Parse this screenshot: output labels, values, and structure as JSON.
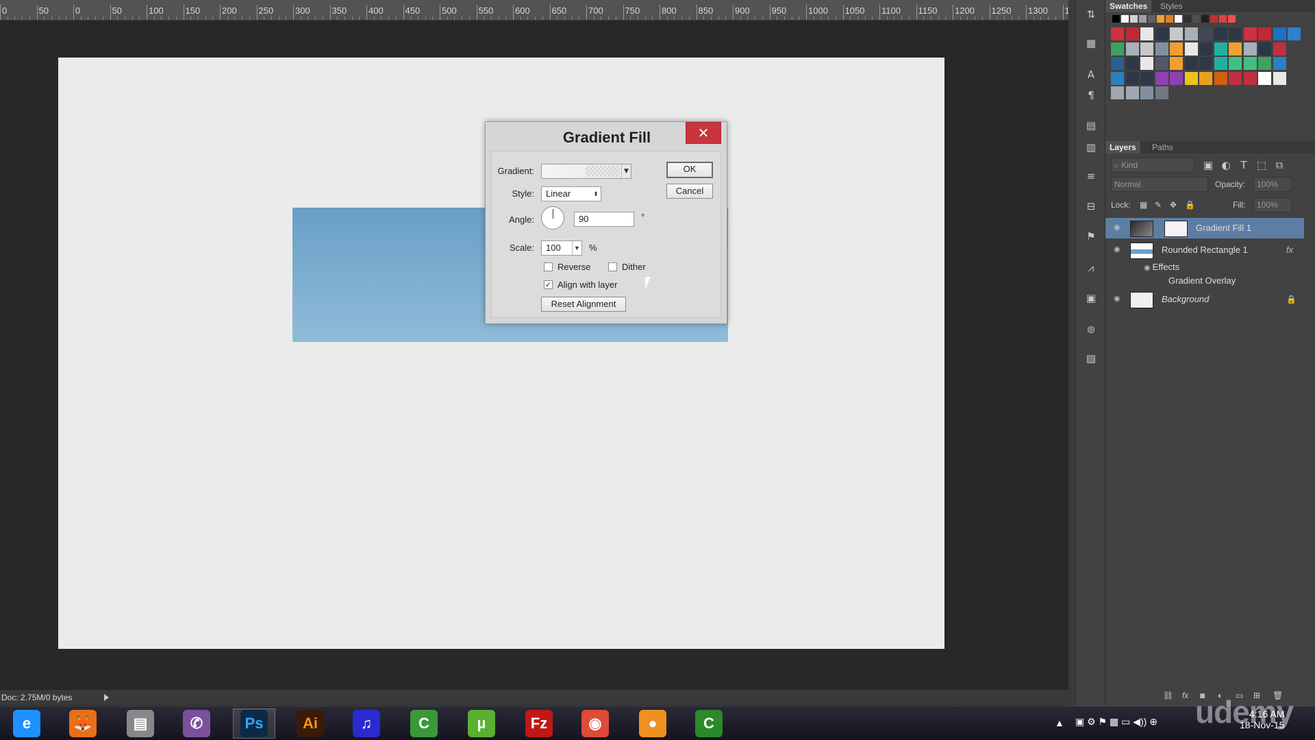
{
  "ruler": {
    "ticks": [
      "0",
      "50",
      "0",
      "50",
      "100",
      "150",
      "200",
      "250",
      "300",
      "350",
      "400",
      "450",
      "500",
      "550",
      "600",
      "650",
      "700",
      "750",
      "800",
      "850",
      "900",
      "950",
      "1000",
      "1050",
      "1100",
      "1150",
      "1200",
      "1250",
      "1300",
      "1"
    ]
  },
  "dialog": {
    "title": "Gradient Fill",
    "close_glyph": "✕",
    "gradient_label": "Gradient:",
    "style_label": "Style:",
    "style_value": "Linear",
    "angle_label": "Angle:",
    "angle_value": "90",
    "angle_unit": "°",
    "scale_label": "Scale:",
    "scale_value": "100",
    "scale_unit": "%",
    "reverse_label": "Reverse",
    "reverse_checked": false,
    "dither_label": "Dither",
    "dither_checked": false,
    "align_label": "Align with layer",
    "align_checked": true,
    "reset_label": "Reset Alignment",
    "ok_label": "OK",
    "cancel_label": "Cancel"
  },
  "status": {
    "doc_info": "Doc: 2.75M/0 bytes"
  },
  "swatches_panel": {
    "tabs": [
      "Swatches",
      "Styles"
    ],
    "top_row": [
      "#000000",
      "#ffffff",
      "#d0d0d0",
      "#a0a0a0",
      "#606060",
      "#f0a030",
      "#e08020",
      "#ffffff",
      "#303030",
      "#505050",
      "#202020",
      "#c03030",
      "#e04040",
      "#f05050"
    ],
    "grid": [
      [
        "#d03040",
        "#c02838",
        "#e8e8e8",
        "#303848",
        "#c8c8c8",
        "#a8b0b8",
        "#404858",
        "#2a3848",
        "#303848",
        "#d03040",
        "#c02838",
        "#2070c0",
        "#3080d0"
      ],
      [
        "#40a060",
        "#a8b0b8",
        "#c8c8c8",
        "#8090a0",
        "#f0a030",
        "#e8e8e8",
        "#303848",
        "#20b0a0",
        "#f0a030",
        "#a8b0b8",
        "#2a3848",
        "#c03040"
      ],
      [
        "#2a6090",
        "#303848",
        "#e8e8e8",
        "#505868",
        "#f0a030",
        "#303848",
        "#303848",
        "#20b0a0",
        "#40c080",
        "#40c080",
        "#40a060",
        "#2a80c0"
      ],
      [
        "#2a80c0",
        "#303848",
        "#303848",
        "#9040b0",
        "#9040b0",
        "#f0c020",
        "#e8a020",
        "#d06010",
        "#c03040",
        "#c03040",
        "#ffffff",
        "#e8e8e8"
      ],
      [
        "#a0a8b0",
        "#a0a8b0",
        "#8090a0",
        "#707880"
      ]
    ]
  },
  "layers_panel": {
    "tabs": [
      "Layers",
      "Paths"
    ],
    "kind_label": "Kind",
    "blend_mode": "Normal",
    "opacity_label": "Opacity:",
    "opacity_value": "100%",
    "lock_label": "Lock:",
    "fill_label": "Fill:",
    "fill_value": "100%",
    "layers": [
      {
        "name": "Gradient Fill 1",
        "selected": true
      },
      {
        "name": "Rounded Rectangle 1",
        "selected": false,
        "fx": "fx"
      },
      {
        "name": "Effects"
      },
      {
        "name": "Gradient Overlay"
      },
      {
        "name": "Background",
        "locked": true
      }
    ]
  },
  "taskbar": {
    "apps": [
      {
        "name": "internet-explorer",
        "glyph": "e",
        "color": "#1e90ff"
      },
      {
        "name": "firefox",
        "glyph": "🦊",
        "color": "#e8701a"
      },
      {
        "name": "file-manager",
        "glyph": "▤",
        "color": "#888888"
      },
      {
        "name": "viber",
        "glyph": "✆",
        "color": "#7b519d"
      },
      {
        "name": "photoshop",
        "glyph": "Ps",
        "color": "#0c2a46"
      },
      {
        "name": "illustrator",
        "glyph": "Ai",
        "color": "#3a1a06"
      },
      {
        "name": "audio-app",
        "glyph": "♫",
        "color": "#2a2ad0"
      },
      {
        "name": "camtasia",
        "glyph": "C",
        "color": "#3a9a3a"
      },
      {
        "name": "utorrent",
        "glyph": "µ",
        "color": "#5ab030"
      },
      {
        "name": "filezilla",
        "glyph": "Fz",
        "color": "#c01818"
      },
      {
        "name": "chrome",
        "glyph": "◉",
        "color": "#dd4b39"
      },
      {
        "name": "media-player",
        "glyph": "●",
        "color": "#f09020"
      },
      {
        "name": "camtasia-2",
        "glyph": "C",
        "color": "#2a8a2a"
      }
    ],
    "clock_time": "4:16 AM",
    "clock_date": "18-Nov-15"
  },
  "watermark": "udemy"
}
